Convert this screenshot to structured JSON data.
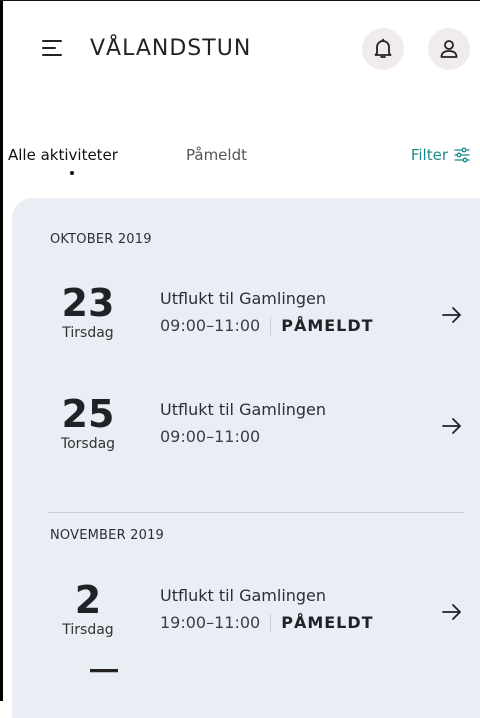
{
  "header": {
    "title": "VÅLANDSTUN"
  },
  "tabs": [
    {
      "label": "Alle aktiviteter"
    },
    {
      "label": "Påmeldt"
    }
  ],
  "filter": {
    "label": "Filter"
  },
  "sections": [
    {
      "title": "OKTOBER 2019",
      "events": [
        {
          "day": "23",
          "weekday": "Tirsdag",
          "title": "Utflukt til Gamlingen",
          "time": "09:00–11:00",
          "status": "PÅMELDT"
        },
        {
          "day": "25",
          "weekday": "Torsdag",
          "title": "Utflukt til Gamlingen",
          "time": "09:00–11:00",
          "status": ""
        }
      ]
    },
    {
      "title": "NOVEMBER 2019",
      "events": [
        {
          "day": "2",
          "weekday": "Tirsdag",
          "title": "Utflukt til Gamlingen",
          "time": "19:00–11:00",
          "status": "PÅMELDT"
        }
      ]
    }
  ],
  "colors": {
    "accent": "#1c8a8a",
    "panel": "#e9eef4",
    "icon_button_bg": "#f1ebeb"
  },
  "icons": [
    "hamburger-icon",
    "bell-icon",
    "user-icon",
    "filter-icon",
    "arrow-right-icon"
  ]
}
